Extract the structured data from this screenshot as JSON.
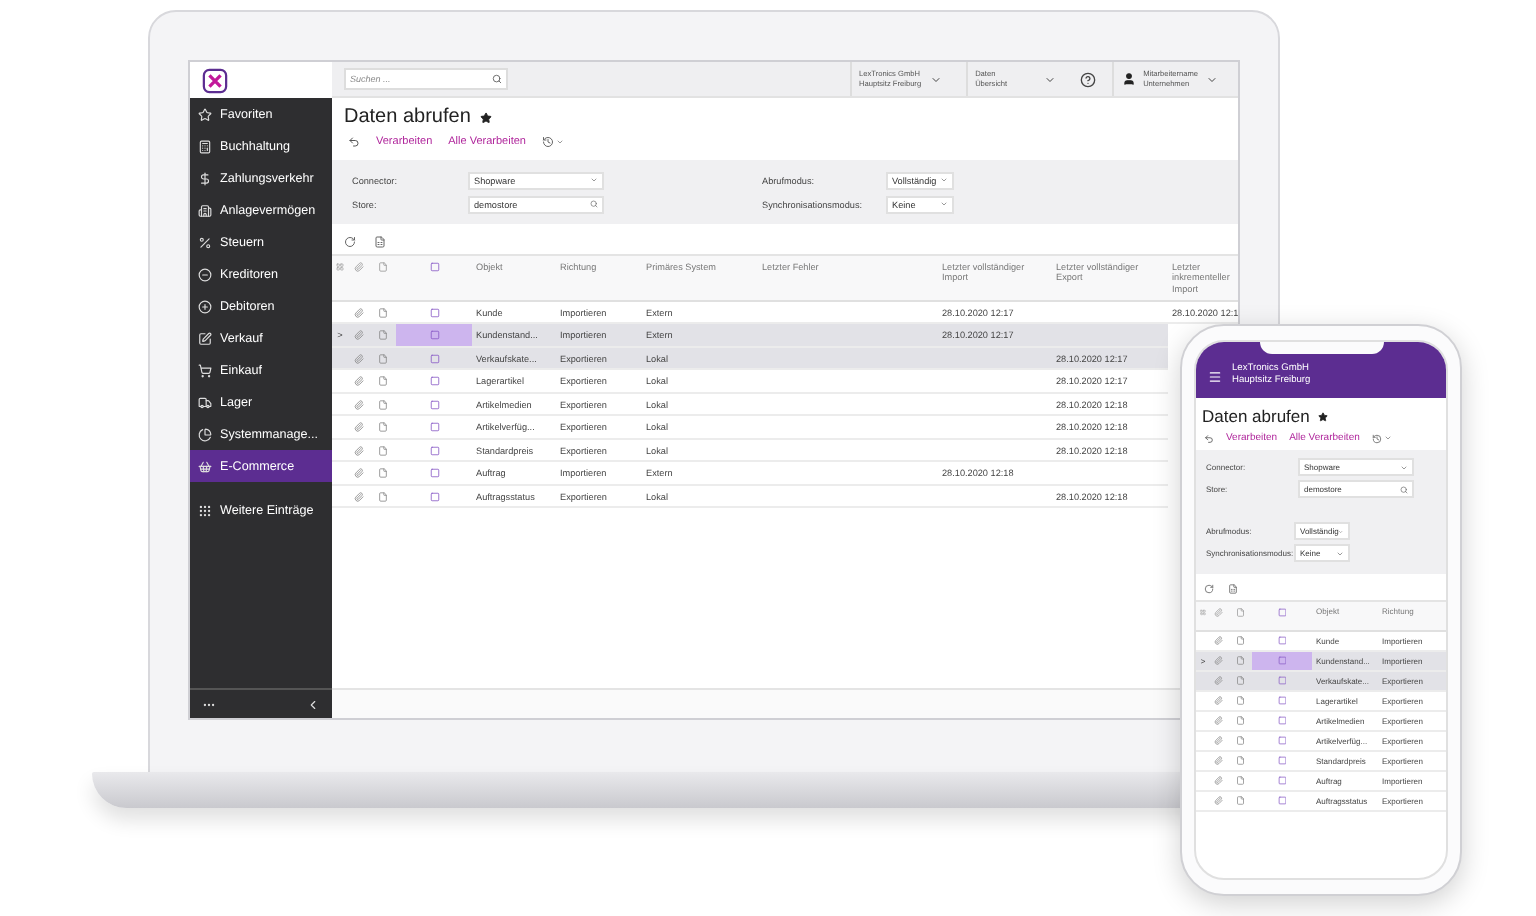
{
  "laptop": {
    "search": {
      "placeholder": "Suchen ..."
    },
    "company": {
      "name": "LexTronics GmbH",
      "site": "Hauptsitz Freiburg"
    },
    "view": {
      "line1": "Daten",
      "line2": "Übersicht"
    },
    "user": {
      "name": "Mitarbeitername",
      "company": "Unternehmen"
    },
    "sidebar": {
      "items": [
        {
          "label": "Favoriten",
          "selected": false
        },
        {
          "label": "Buchhaltung",
          "selected": false
        },
        {
          "label": "Zahlungsverkehr",
          "selected": false
        },
        {
          "label": "Anlagevermögen",
          "selected": false
        },
        {
          "label": "Steuern",
          "selected": false
        },
        {
          "label": "Kreditoren",
          "selected": false
        },
        {
          "label": "Debitoren",
          "selected": false
        },
        {
          "label": "Verkauf",
          "selected": false
        },
        {
          "label": "Einkauf",
          "selected": false
        },
        {
          "label": "Lager",
          "selected": false
        },
        {
          "label": "Systemmanage...",
          "selected": false
        },
        {
          "label": "E-Commerce",
          "selected": true
        }
      ],
      "more": "Weitere Einträge"
    },
    "page": {
      "title": "Daten abrufen",
      "actions": [
        "Verarbeiten",
        "Alle Verarbeiten"
      ]
    },
    "filters": [
      {
        "label": "Connector:",
        "value": "Shopware",
        "kind": "select"
      },
      {
        "label": "Store:",
        "value": "demostore",
        "kind": "search"
      },
      {
        "label": "Abrufmodus:",
        "value": "Vollständig",
        "kind": "select"
      },
      {
        "label": "Synchronisationsmodus:",
        "value": "Keine",
        "kind": "select"
      }
    ],
    "table": {
      "select_all": {
        "checked": false
      },
      "columns": [
        "Objekt",
        "Richtung",
        "Primäres System",
        "Letzter Fehler",
        "Letzter vollständiger Import",
        "Letzter vollständiger Export",
        "Letzter inkrementeller Import"
      ],
      "rows": [
        {
          "cells": [
            "Kunde",
            "Importieren",
            "Extern",
            "",
            "28.10.2020 12:17",
            "",
            "28.10.2020 12:1"
          ],
          "highlighted": false,
          "selected": false
        },
        {
          "cells": [
            "Kundenstand...",
            "Importieren",
            "Extern",
            "",
            "28.10.2020 12:17",
            "",
            ""
          ],
          "highlighted": true,
          "selected": true,
          "expander": ">"
        },
        {
          "cells": [
            "Verkaufskate...",
            "Exportieren",
            "Lokal",
            "",
            "",
            "28.10.2020 12:17",
            ""
          ],
          "highlighted": true,
          "selected": false
        },
        {
          "cells": [
            "Lagerartikel",
            "Exportieren",
            "Lokal",
            "",
            "",
            "28.10.2020 12:17",
            ""
          ],
          "highlighted": false,
          "selected": false
        },
        {
          "cells": [
            "Artikelmedien",
            "Exportieren",
            "Lokal",
            "",
            "",
            "28.10.2020 12:18",
            ""
          ],
          "highlighted": false,
          "selected": false
        },
        {
          "cells": [
            "Artikelverfüg...",
            "Exportieren",
            "Lokal",
            "",
            "",
            "28.10.2020 12:18",
            ""
          ],
          "highlighted": false,
          "selected": false
        },
        {
          "cells": [
            "Standardpreis",
            "Exportieren",
            "Lokal",
            "",
            "",
            "28.10.2020 12:18",
            ""
          ],
          "highlighted": false,
          "selected": false
        },
        {
          "cells": [
            "Auftrag",
            "Importieren",
            "Extern",
            "",
            "28.10.2020 12:18",
            "",
            ""
          ],
          "highlighted": false,
          "selected": false
        },
        {
          "cells": [
            "Auftragsstatus",
            "Exportieren",
            "Lokal",
            "",
            "",
            "28.10.2020 12:18",
            ""
          ],
          "highlighted": false,
          "selected": false
        }
      ]
    }
  },
  "phone": {
    "company": {
      "name": "LexTronics GmbH",
      "site": "Hauptsitz Freiburg"
    },
    "page": {
      "title": "Daten abrufen",
      "actions": [
        "Verarbeiten",
        "Alle Verarbeiten"
      ]
    },
    "filters": [
      {
        "label": "Connector:",
        "value": "Shopware",
        "kind": "select"
      },
      {
        "label": "Store:",
        "value": "demostore",
        "kind": "search"
      },
      {
        "label": "Abrufmodus:",
        "value": "Vollständig",
        "kind": "select"
      },
      {
        "label": "Synchronisationsmodus:",
        "value": "Keine",
        "kind": "select"
      }
    ],
    "table": {
      "select_all": {
        "checked": false
      },
      "columns": [
        "Objekt",
        "Richtung"
      ],
      "rows": [
        {
          "cells": [
            "Kunde",
            "Importieren"
          ],
          "highlighted": false,
          "selected": false
        },
        {
          "cells": [
            "Kundenstand...",
            "Importieren"
          ],
          "highlighted": true,
          "selected": true,
          "expander": ">"
        },
        {
          "cells": [
            "Verkaufskate...",
            "Exportieren"
          ],
          "highlighted": true,
          "selected": false
        },
        {
          "cells": [
            "Lagerartikel",
            "Exportieren"
          ],
          "highlighted": false,
          "selected": false
        },
        {
          "cells": [
            "Artikelmedien",
            "Exportieren"
          ],
          "highlighted": false,
          "selected": false
        },
        {
          "cells": [
            "Artikelverfüg...",
            "Exportieren"
          ],
          "highlighted": false,
          "selected": false
        },
        {
          "cells": [
            "Standardpreis",
            "Exportieren"
          ],
          "highlighted": false,
          "selected": false
        },
        {
          "cells": [
            "Auftrag",
            "Importieren"
          ],
          "highlighted": false,
          "selected": false
        },
        {
          "cells": [
            "Auftragsstatus",
            "Exportieren"
          ],
          "highlighted": false,
          "selected": false
        }
      ]
    }
  }
}
